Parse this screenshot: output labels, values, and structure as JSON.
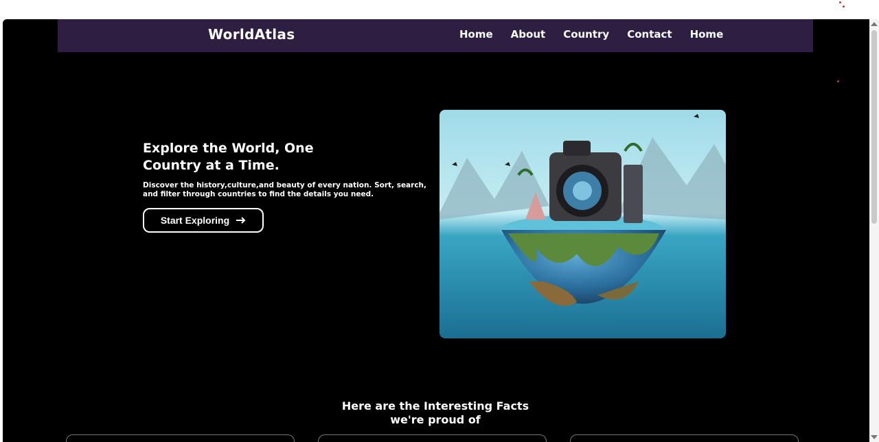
{
  "brand": "WorldAtlas",
  "nav": [
    "Home",
    "About",
    "Country",
    "Contact",
    "Home"
  ],
  "hero": {
    "title_line1": "Explore the World, One",
    "title_line2": "Country at a Time.",
    "description": "Discover the history,culture,and beauty of every nation. Sort, search, and filter through countries to find the details you need.",
    "cta_label": "Start Exploring",
    "cta_icon": "arrow-right-icon"
  },
  "facts": {
    "title_line1": "Here are the Interesting Facts",
    "title_line2": "we're proud of"
  },
  "colors": {
    "navbar_bg": "#2e1f42",
    "page_bg": "#000000",
    "text": "#ffffff"
  }
}
